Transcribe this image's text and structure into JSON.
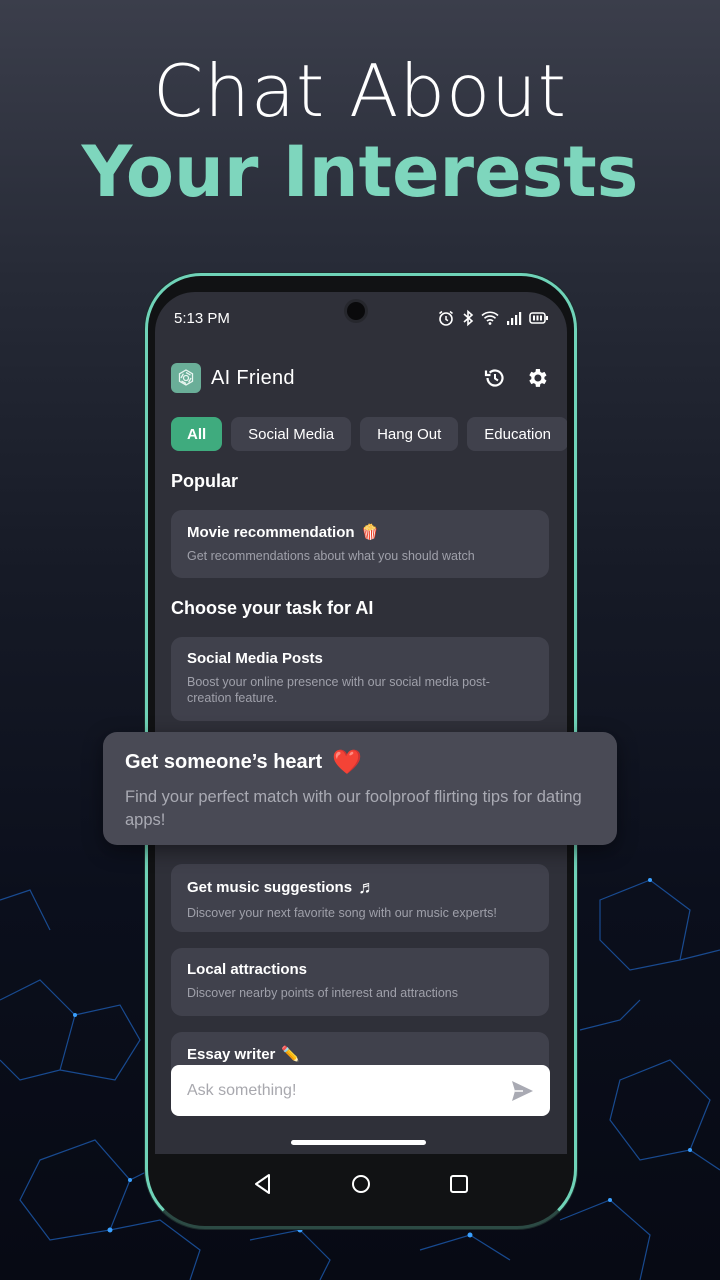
{
  "headline": {
    "line1": "Chat About",
    "line2": "Your Interests"
  },
  "colors": {
    "accent_green": "#3fab7e",
    "headline_mint": "#7ed6bd",
    "card_bg": "#40414c",
    "screen_bg": "#2f3039"
  },
  "status_bar": {
    "time": "5:13 PM",
    "icons": [
      "alarm-icon",
      "bluetooth-icon",
      "wifi-icon",
      "signal-icon",
      "battery-icon"
    ]
  },
  "app_bar": {
    "title": "AI Friend",
    "logo_icon": "ai-logo-icon",
    "actions": [
      "history-icon",
      "settings-gear-icon"
    ]
  },
  "filters": {
    "chips": [
      {
        "label": "All",
        "active": true
      },
      {
        "label": "Social Media",
        "active": false
      },
      {
        "label": "Hang Out",
        "active": false
      },
      {
        "label": "Education",
        "active": false
      }
    ]
  },
  "popular": {
    "title": "Popular",
    "items": [
      {
        "title": "Movie recommendation",
        "emoji": "🍿",
        "description": "Get recommendations about what you should watch"
      }
    ]
  },
  "tasks": {
    "title": "Choose your task for AI",
    "items": [
      {
        "title": "Social Media Posts",
        "emoji": "",
        "description": "Boost your online presence with our social media post-creation feature."
      },
      {
        "title": "Get music suggestions",
        "emoji": "♬",
        "description": "Discover your next favorite song with our music experts!"
      },
      {
        "title": "Local attractions",
        "emoji": "",
        "description": "Discover nearby points of interest and attractions"
      },
      {
        "title": "Essay writer",
        "emoji": "✏️",
        "description": ""
      }
    ]
  },
  "highlight_card": {
    "title": "Get someone’s heart",
    "emoji": "❤️",
    "description": "Find your perfect match with our foolproof flirting tips for dating apps!"
  },
  "input": {
    "placeholder": "Ask something!",
    "value": ""
  },
  "nav": {
    "buttons": [
      "back",
      "home",
      "recents"
    ]
  }
}
